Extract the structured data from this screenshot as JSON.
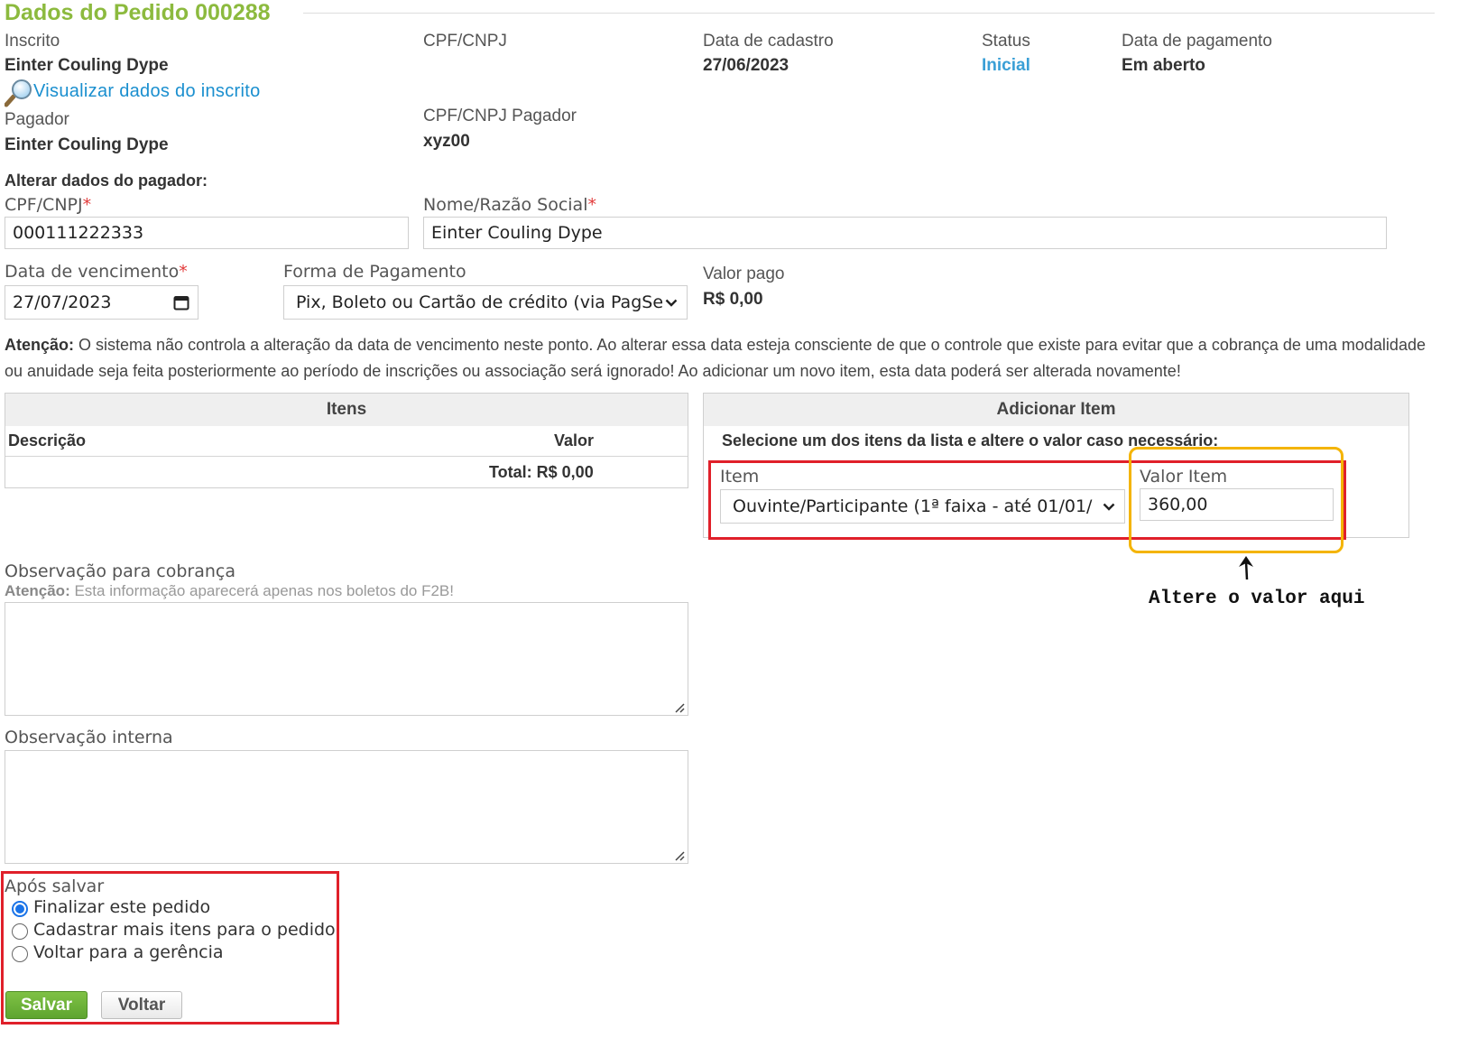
{
  "title": "Dados do Pedido 000288",
  "summary": {
    "inscrito_label": "Inscrito",
    "inscrito_value": "Einter Couling Dype",
    "cpf_label": "CPF/CNPJ",
    "cpf_value": "",
    "data_cadastro_label": "Data de cadastro",
    "data_cadastro_value": "27/06/2023",
    "status_label": "Status",
    "status_value": "Inicial",
    "data_pagamento_label": "Data de pagamento",
    "data_pagamento_value": "Em aberto",
    "view_link": "Visualizar dados do inscrito",
    "pagador_label": "Pagador",
    "pagador_value": "Einter Couling Dype",
    "cpf_pagador_label": "CPF/CNPJ Pagador",
    "cpf_pagador_value": "xyz00"
  },
  "payer_form": {
    "heading": "Alterar dados do pagador:",
    "cpf_label": "CPF/CNPJ",
    "cpf_value": "000111222333",
    "nome_label": "Nome/Razão Social",
    "nome_value": "Einter Couling Dype",
    "required_mark": "*"
  },
  "payment": {
    "vencimento_label": "Data de vencimento",
    "vencimento_value": "27/07/2023",
    "forma_label": "Forma de Pagamento",
    "forma_value": "Pix, Boleto ou Cartão de crédito (via PagSe",
    "valor_pago_label": "Valor pago",
    "valor_pago_value": "R$ 0,00"
  },
  "notice": {
    "bold": "Atenção:",
    "text": " O sistema não controla a alteração da data de vencimento neste ponto. Ao alterar essa data esteja consciente de que o controle que existe para evitar que a cobrança de uma modalidade ou anuidade seja feita posteriormente ao período de inscrições ou associação será ignorado! Ao adicionar um novo item, esta data poderá ser alterada novamente!"
  },
  "items_table": {
    "header": "Itens",
    "col_desc": "Descrição",
    "col_valor": "Valor",
    "total": "Total: R$ 0,00"
  },
  "add_item": {
    "header": "Adicionar Item",
    "instruction": "Selecione um dos itens da lista e altere o valor caso necessário:",
    "item_label": "Item",
    "item_value": "Ouvinte/Participante (1ª faixa - até 01/01/",
    "valor_label": "Valor Item",
    "valor_value": "360,00"
  },
  "annotation": {
    "text": "Altere o valor aqui"
  },
  "obs_cobranca": {
    "label": "Observação para cobrança",
    "hint_bold": "Atenção:",
    "hint_text": " Esta informação aparecerá apenas nos boletos do F2B!"
  },
  "obs_interna": {
    "label": "Observação interna"
  },
  "after_save": {
    "label": "Após salvar",
    "options": [
      {
        "label": "Finalizar este pedido",
        "checked": true
      },
      {
        "label": "Cadastrar mais itens para o pedido",
        "checked": false
      },
      {
        "label": "Voltar para a gerência",
        "checked": false
      }
    ]
  },
  "buttons": {
    "save": "Salvar",
    "back": "Voltar"
  },
  "colors": {
    "title_green": "#8cba3e",
    "link_blue": "#1a8fcf",
    "status_blue": "#3a9fd6",
    "annotation_red": "#e0202a",
    "annotation_yellow": "#f4b400",
    "save_green": "#6bb33a"
  }
}
